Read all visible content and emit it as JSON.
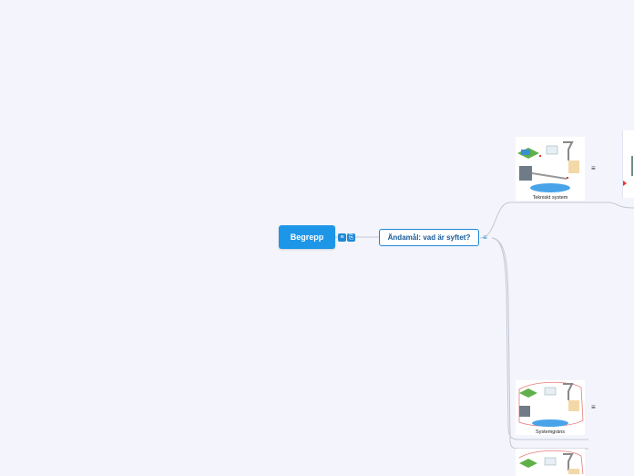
{
  "root": {
    "label": "Begrepp"
  },
  "root_icons": [
    "note-icon",
    "link-icon"
  ],
  "main_topic": {
    "label": "Ändamål: vad är syftet?"
  },
  "subtopics": [
    {
      "label": "Tekniskt system"
    },
    {
      "label": "Systemgräns"
    },
    {
      "label": ""
    }
  ],
  "colors": {
    "background": "#f4f5fc",
    "root_fill": "#1e96e8",
    "topic_border": "#1e88d6",
    "connector": "#c3c7d3"
  }
}
